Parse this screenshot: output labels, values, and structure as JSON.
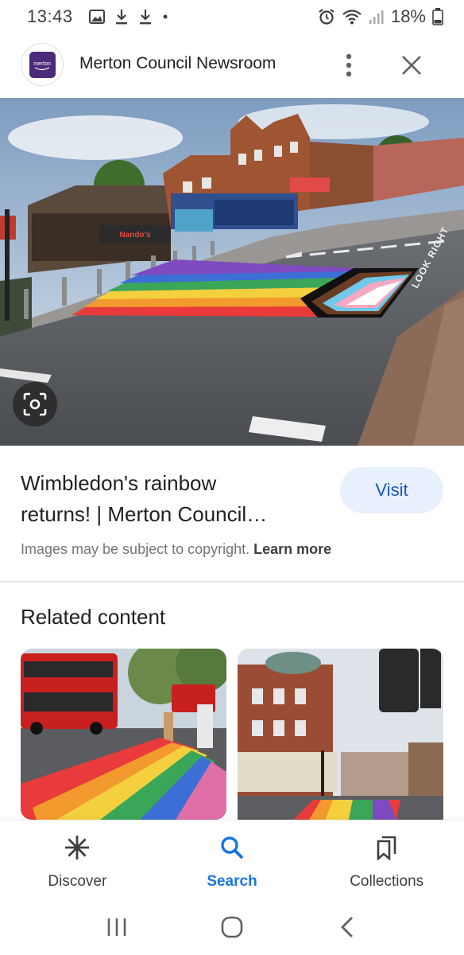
{
  "status_bar": {
    "time": "13:43",
    "battery": "18%"
  },
  "header": {
    "title": "Merton Council Newsroom",
    "logo_text": "merton"
  },
  "result": {
    "title_line1": "Wimbledon's rainbow",
    "title_line2": "returns! | Merton Council…",
    "visit_label": "Visit",
    "copyright_text": "Images may be subject to copyright.",
    "learn_more_label": "Learn more"
  },
  "related": {
    "heading": "Related content"
  },
  "bottom_nav": {
    "items": [
      {
        "label": "Discover",
        "icon": "asterisk-icon"
      },
      {
        "label": "Search",
        "icon": "search-icon"
      },
      {
        "label": "Collections",
        "icon": "bookmarks-icon"
      }
    ]
  },
  "image_text": {
    "shop_sign": "Nando's",
    "road_marking": "LOOK RIGHT"
  },
  "colors": {
    "accent": "#1a73e8",
    "visit_bg": "#e8f0fe",
    "logo_bg": "#4a2b7a"
  }
}
